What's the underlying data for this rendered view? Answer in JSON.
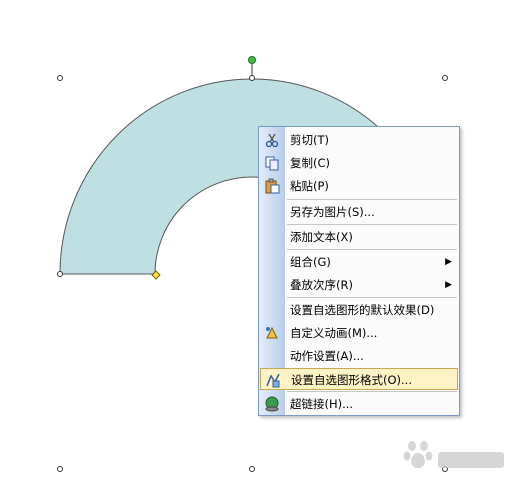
{
  "menu": {
    "items": [
      {
        "label": "剪切(T)",
        "icon": "scissors-icon"
      },
      {
        "label": "复制(C)",
        "icon": "copy-icon"
      },
      {
        "label": "粘贴(P)",
        "icon": "paste-icon"
      },
      {
        "label": "另存为图片(S)..."
      },
      {
        "label": "添加文本(X)"
      },
      {
        "label": "组合(G)",
        "submenu": true
      },
      {
        "label": "叠放次序(R)",
        "submenu": true
      },
      {
        "label": "设置自选图形的默认效果(D)"
      },
      {
        "label": "自定义动画(M)...",
        "icon": "animation-icon"
      },
      {
        "label": "动作设置(A)..."
      },
      {
        "label": "设置自选图形格式(O)...",
        "icon": "format-shape-icon",
        "highlighted": true
      },
      {
        "label": "超链接(H)...",
        "icon": "hyperlink-icon"
      }
    ]
  },
  "shape": {
    "fill": "#bfe0e3",
    "stroke": "#555555"
  },
  "colors": {
    "menu_border": "#7a9ac8",
    "highlight": "#fdf3c4"
  }
}
